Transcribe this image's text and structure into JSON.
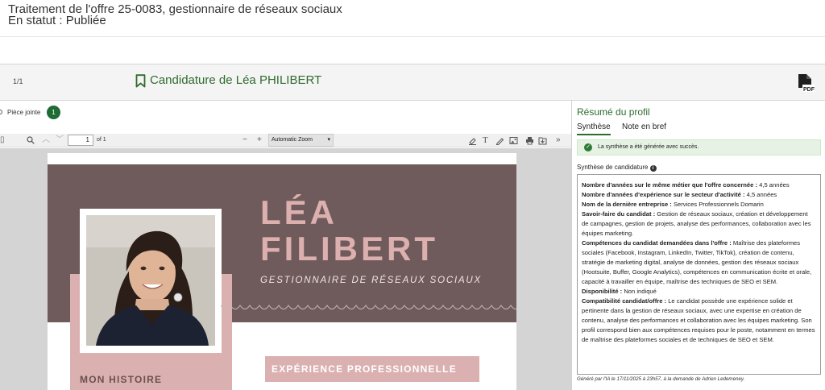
{
  "header": {
    "title": "Traitement de l'offre 25-0083, gestionnaire de réseaux sociaux",
    "status": "En statut : Publiée"
  },
  "candidature_bar": {
    "counter": "1/1",
    "title": "Candidature de Léa PHILIBERT",
    "bookmark_icon": "bookmark-icon",
    "pdf_icon": "pdf-icon"
  },
  "attachments": {
    "label": "Pièce jointe",
    "count": "1"
  },
  "pdf_toolbar": {
    "page": "1",
    "of_pages": "of 1",
    "zoom": "Automatic Zoom"
  },
  "cv": {
    "first_name": "LÉA",
    "last_name": "FILIBERT",
    "role": "GESTIONNAIRE DE RÉSEAUX SOCIAUX",
    "section_experience": "EXPÉRIENCE PROFESSIONNELLE",
    "section_story": "MON HISTOIRE",
    "colors": {
      "band": "#6f5a5c",
      "accent": "#dbb0b0",
      "name": "#dcb0ae"
    }
  },
  "profile": {
    "title": "Résumé du profil",
    "tabs": [
      "Synthèse",
      "Note en bref"
    ],
    "alert": "La synthèse a été générée avec succès.",
    "synth_label": "Synthèse de candidature",
    "entries": [
      {
        "label": "Nombre d'années sur le même métier que l'offre concernée :",
        "value": "4,5 années"
      },
      {
        "label": "Nombre d'années d'expérience sur le secteur d'activité :",
        "value": "4,5 années"
      },
      {
        "label": "Nom de la dernière entreprise :",
        "value": "Services Professionnels Domarin"
      },
      {
        "label": "Savoir-faire du candidat :",
        "value": "Gestion de réseaux sociaux, création et développement de campagnes, gestion de projets, analyse des performances, collaboration avec les équipes marketing."
      },
      {
        "label": "Compétences du candidat demandées dans l'offre :",
        "value": "Maîtrise des plateformes sociales (Facebook, Instagram, LinkedIn, Twitter, TikTok), création de contenu, stratégie de marketing digital, analyse de données, gestion des réseaux sociaux (Hootsuite, Buffer, Google Analytics), compétences en communication écrite et orale, capacité à travailler en équipe, maîtrise des techniques de SEO et SEM."
      },
      {
        "label": "Disponibilité :",
        "value": "Non indiqué"
      },
      {
        "label": "Compatibilité candidat/offre :",
        "value": "Le candidat possède une expérience solide et pertinente dans la gestion de réseaux sociaux, avec une expertise en création de contenu, analyse des performances et collaboration avec les équipes marketing. Son profil correspond bien aux compétences requises pour le poste, notamment en termes de maîtrise des plateformes sociales et de techniques de SEO et SEM."
      }
    ],
    "footer": "Généré par l'IA le 17/11/2025 à 23h57, à la demande de Adrien Ledemeney."
  }
}
